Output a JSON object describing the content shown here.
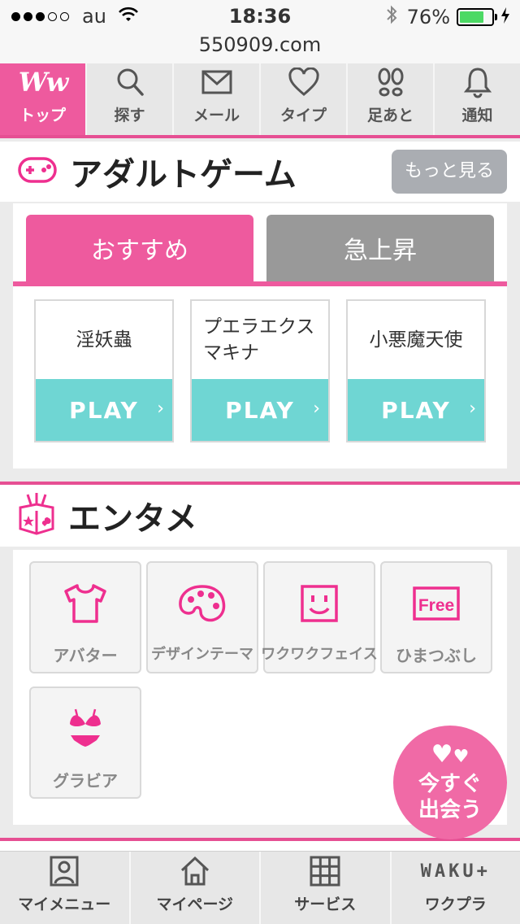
{
  "status_bar": {
    "carrier": "au",
    "time": "18:36",
    "battery_percent_text": "76%",
    "battery_level": 0.76
  },
  "url": "550909.com",
  "nav": {
    "items": [
      {
        "label": "トップ",
        "icon": "ww-logo-icon",
        "logo_text": "Ww",
        "active": true
      },
      {
        "label": "探す",
        "icon": "search-icon"
      },
      {
        "label": "メール",
        "icon": "mail-icon"
      },
      {
        "label": "タイプ",
        "icon": "heart-icon"
      },
      {
        "label": "足あと",
        "icon": "footprints-icon"
      },
      {
        "label": "通知",
        "icon": "bell-icon"
      }
    ]
  },
  "games": {
    "title": "アダルトゲーム",
    "more_label": "もっと見る",
    "tabs": [
      {
        "label": "おすすめ",
        "active": true
      },
      {
        "label": "急上昇",
        "active": false
      }
    ],
    "cards": [
      {
        "name": "淫妖蟲",
        "play": "PLAY"
      },
      {
        "name": "プエラエクスマキナ",
        "play": "PLAY"
      },
      {
        "name": "小悪魔天使",
        "play": "PLAY"
      }
    ]
  },
  "entertainment": {
    "title": "エンタメ",
    "tiles": [
      {
        "label": "アバター",
        "icon": "tshirt-icon"
      },
      {
        "label": "デザインテーマ",
        "icon": "palette-icon"
      },
      {
        "label": "ワクワクフェイス",
        "icon": "smiley-face-icon"
      },
      {
        "label": "ひまつぶし",
        "icon": "free-badge-icon",
        "badge": "Free"
      },
      {
        "label": "グラビア",
        "icon": "bikini-icon"
      }
    ]
  },
  "float_button": {
    "line1": "今すぐ",
    "line2": "出会う"
  },
  "bottom_bar": {
    "items": [
      {
        "label": "マイメニュー",
        "icon": "profile-icon"
      },
      {
        "label": "マイページ",
        "icon": "home-icon"
      },
      {
        "label": "サービス",
        "icon": "grid-icon"
      },
      {
        "label": "ワクプラ",
        "icon": "waku-plus-logo-icon",
        "logo_text": "WAKU+"
      }
    ]
  },
  "colors": {
    "accent_pink": "#ee5a9e",
    "rule_pink": "#e64f93",
    "play_teal": "#6fd6d3",
    "tab_gray": "#999999",
    "icon_pink": "#ee2f8f"
  }
}
